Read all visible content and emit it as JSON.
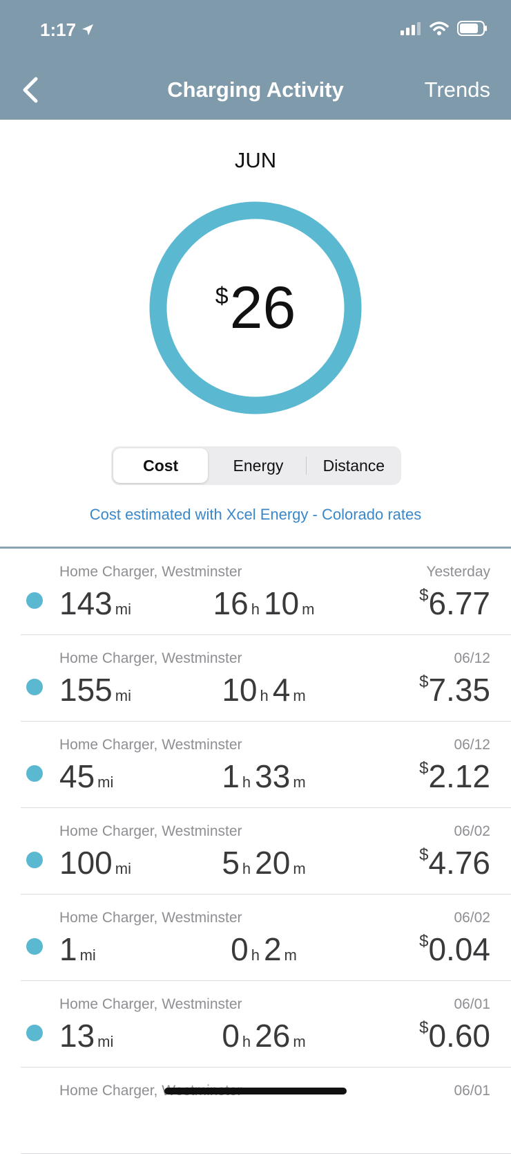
{
  "status_bar": {
    "time": "1:17",
    "icons": [
      "location-arrow-icon",
      "signal-icon",
      "wifi-icon",
      "battery-icon"
    ]
  },
  "nav": {
    "title": "Charging Activity",
    "right_label": "Trends",
    "back_icon": "chevron-left-icon"
  },
  "summary": {
    "month": "JUN",
    "currency": "$",
    "amount": "26",
    "ring_color": "#5bb8d1"
  },
  "tabs": {
    "items": [
      "Cost",
      "Energy",
      "Distance"
    ],
    "selected": "Cost"
  },
  "note": "Cost estimated with Xcel Energy - Colorado rates",
  "units": {
    "miles": "mi",
    "hours": "h",
    "minutes": "m",
    "currency": "$"
  },
  "sessions": [
    {
      "location": "Home Charger, Westminster",
      "date": "Yesterday",
      "miles": "143",
      "hours": "16",
      "minutes": "10",
      "cost": "6.77"
    },
    {
      "location": "Home Charger, Westminster",
      "date": "06/12",
      "miles": "155",
      "hours": "10",
      "minutes": "4",
      "cost": "7.35"
    },
    {
      "location": "Home Charger, Westminster",
      "date": "06/12",
      "miles": "45",
      "hours": "1",
      "minutes": "33",
      "cost": "2.12"
    },
    {
      "location": "Home Charger, Westminster",
      "date": "06/02",
      "miles": "100",
      "hours": "5",
      "minutes": "20",
      "cost": "4.76"
    },
    {
      "location": "Home Charger, Westminster",
      "date": "06/02",
      "miles": "1",
      "hours": "0",
      "minutes": "2",
      "cost": "0.04"
    },
    {
      "location": "Home Charger, Westminster",
      "date": "06/01",
      "miles": "13",
      "hours": "0",
      "minutes": "26",
      "cost": "0.60"
    },
    {
      "location": "Home Charger, Westminster",
      "date": "06/01"
    }
  ],
  "colors": {
    "header": "#7f9aab",
    "accent": "#5bb8d1",
    "link": "#3a87c9"
  }
}
